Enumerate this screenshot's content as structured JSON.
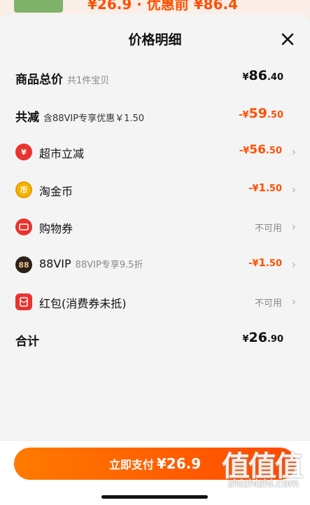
{
  "peek": {
    "text": "¥26.9 · 优惠前 ¥86.4"
  },
  "header": {
    "title": "价格明细",
    "close_icon": "close-icon"
  },
  "rows": {
    "total_goods": {
      "label": "商品总价",
      "sub": "共1件宝贝",
      "cur": "¥",
      "int": "86",
      "dec": ".40"
    },
    "discount_total": {
      "label": "共减",
      "sub": "含88VIP专享优惠￥1.50",
      "cur": "-¥",
      "int": "59",
      "dec": ".50"
    },
    "supermarket": {
      "label": "超市立减",
      "icon": "¥",
      "cur": "-¥",
      "int": "56",
      "dec": ".50"
    },
    "taojinbi": {
      "label": "淘金币",
      "icon": "币",
      "cur": "-¥",
      "int": "1",
      "dec": ".50"
    },
    "coupon": {
      "label": "购物券",
      "status": "不可用"
    },
    "vip": {
      "label": "88VIP",
      "sub": "88VIP专享9.5折",
      "icon": "88",
      "cur": "-¥",
      "int": "1",
      "dec": ".50"
    },
    "redpacket": {
      "label": "红包(消费券未抵)",
      "status": "不可用"
    },
    "sum": {
      "label": "合计",
      "cur": "¥",
      "int": "26",
      "dec": ".90"
    }
  },
  "pay": {
    "label": "立即支付",
    "amount": "¥26.9"
  },
  "watermark": {
    "logo": "值值值",
    "url": "zhizhizhi.com"
  },
  "colors": {
    "accent": "#ff5000",
    "red_icon": "#e8332e",
    "gold_icon": "#f4b400"
  }
}
